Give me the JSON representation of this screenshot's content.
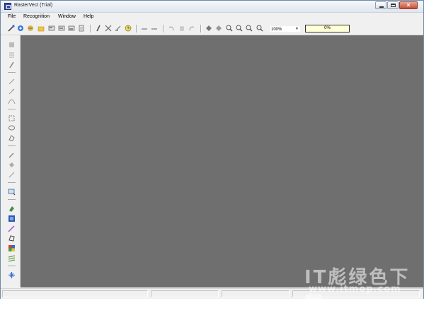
{
  "window": {
    "title": "RasterVect (Trial)"
  },
  "menu": {
    "items": [
      "File",
      "Recognition",
      "Window",
      "Help"
    ]
  },
  "toolbar": {
    "zoom": "100%",
    "progress": "0%",
    "icons": [
      "wand-icon",
      "open-icon",
      "web-icon",
      "folder-icon",
      "page1-icon",
      "page2-icon",
      "page3-icon",
      "page4-icon",
      "pen-icon",
      "scissors-icon",
      "eraser-icon",
      "clock-icon",
      "link1-icon",
      "link2-icon",
      "undo-icon",
      "hand-icon",
      "redo-icon",
      "eye1-icon",
      "eye2-icon",
      "zoom-in-icon",
      "zoom-out-icon",
      "zoom-fit-icon",
      "zoom-sel-icon"
    ]
  },
  "left_tools": [
    "stamp-icon",
    "lines-icon",
    "marker-icon",
    "pencil-icon",
    "magic-icon",
    "curve-icon",
    "rectangle-select-icon",
    "lasso-icon",
    "polygon-icon",
    "brush-icon",
    "fill-icon",
    "line-icon",
    "select-area-icon",
    "color1-icon",
    "color2-icon",
    "pipette-icon",
    "polygon2-icon",
    "palette-icon",
    "layers-icon",
    "snap-icon"
  ],
  "colors": {
    "canvas": "#6f6f6f",
    "chrome": "#f0f0f0",
    "progress_bg": "#ffffd8"
  },
  "watermark": {
    "line1": "IT彪绿色下载",
    "line2": "www.itmop.com"
  }
}
